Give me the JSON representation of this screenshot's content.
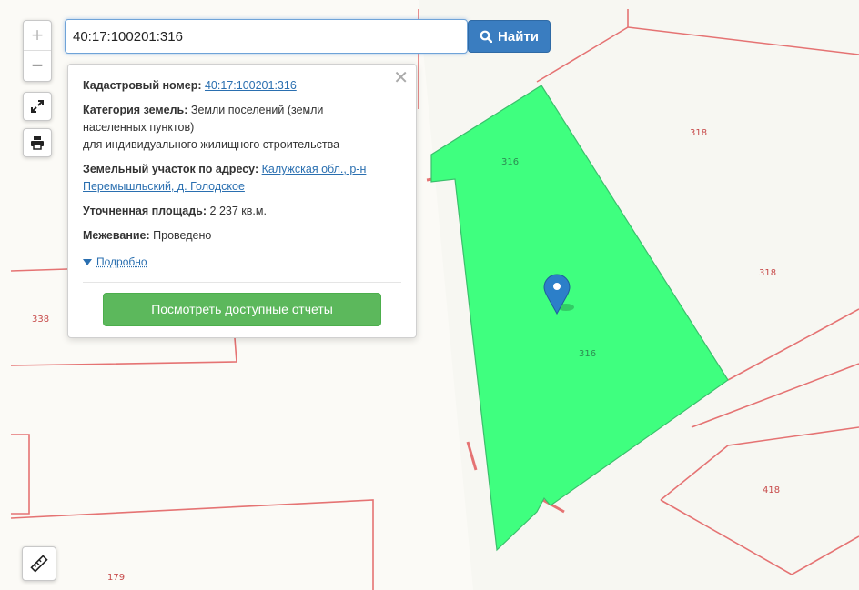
{
  "search": {
    "value": "40:17:100201:316",
    "button_label": "Найти"
  },
  "zoom": {
    "in_label": "+",
    "out_label": "−"
  },
  "popup": {
    "close_label": "✕",
    "cadastral_label": "Кадастровый номер:",
    "cadastral_value": "40:17:100201:316",
    "category_label": "Категория земель:",
    "category_value_1": "Земли поселений (земли",
    "category_value_2": "населенных пунктов)",
    "category_value_3": "для индивидуального жилищного строительства",
    "address_label": "Земельный участок по адресу:",
    "address_value_1": "Калужская обл., р-н",
    "address_value_2": "Перемышльский, д. Голодское",
    "area_label": "Уточненная площадь:",
    "area_value": "2 237 кв.м.",
    "survey_label": "Межевание:",
    "survey_value": "Проведено",
    "details_label": "Подробно",
    "reports_button": "Посмотреть доступные отчеты"
  },
  "map": {
    "parcel_labels": [
      "316",
      "316",
      "318",
      "318",
      "338",
      "418",
      "179"
    ],
    "colors": {
      "selected_fill": "#3fff7f",
      "boundary": "#e57373",
      "background": "#fbfaf6",
      "accent": "#3a7dc0",
      "reports_button": "#5cb85c",
      "marker": "#2c7fc9"
    }
  },
  "icons": [
    "search-icon",
    "expand-icon",
    "print-icon",
    "ruler-icon",
    "map-marker-icon",
    "caret-down-icon",
    "close-icon"
  ]
}
